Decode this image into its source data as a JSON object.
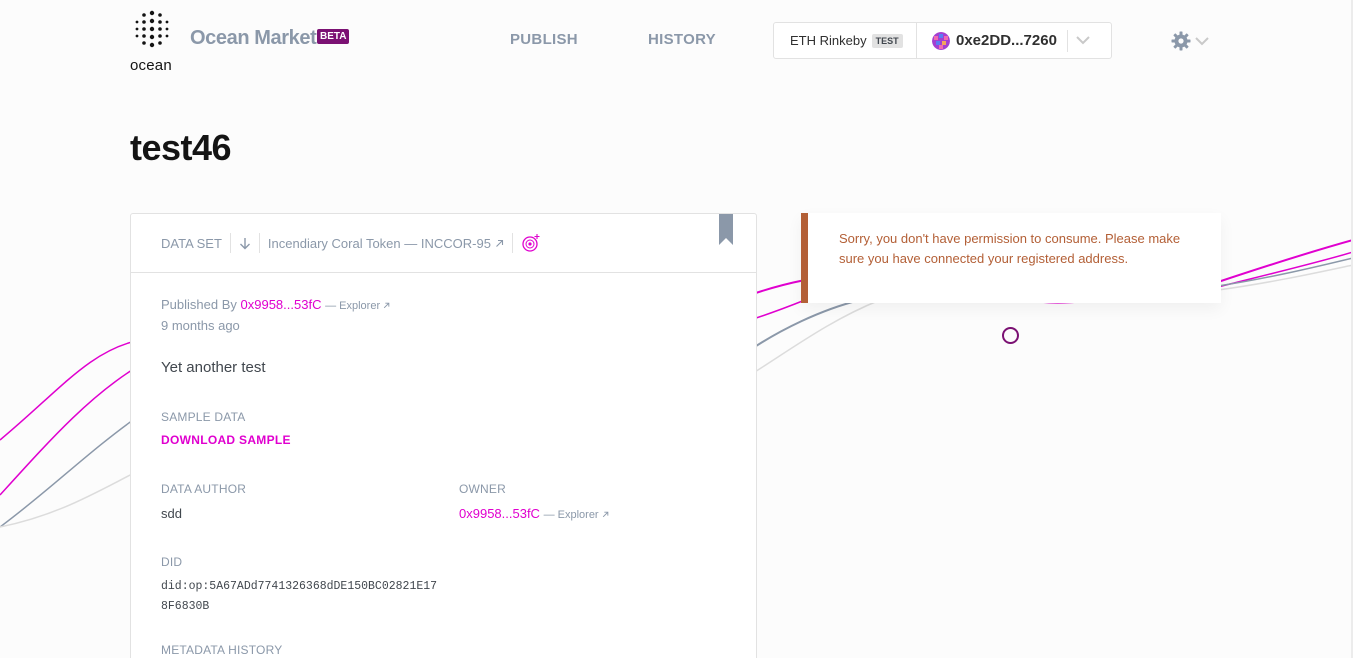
{
  "header": {
    "logo_text": "ocean",
    "brand": "Ocean Market",
    "beta": "BETA",
    "nav": {
      "publish": "PUBLISH",
      "history": "HISTORY"
    },
    "network": {
      "name": "ETH Rinkeby",
      "badge": "TEST"
    },
    "account": {
      "address": "0xe2DD...7260"
    }
  },
  "page": {
    "title": "test46"
  },
  "asset": {
    "type": "DATA SET",
    "token": "Incendiary Coral Token — INCCOR-95",
    "published_by_label": "Published By",
    "publisher": "0x9958...53fC",
    "explorer_label": "— Explorer",
    "published_ago": "9 months ago",
    "description": "Yet another test",
    "sample_label": "SAMPLE DATA",
    "sample_button": "DOWNLOAD SAMPLE",
    "author_label": "DATA AUTHOR",
    "author": "sdd",
    "owner_label": "OWNER",
    "owner": "0x9958...53fC",
    "did_label": "DID",
    "did": "did:op:5A67ADd7741326368dDE150BC02821E178F6830B",
    "metadata_history_label": "METADATA HISTORY"
  },
  "alert": {
    "message": "Sorry, you don't have permission to consume. Please make sure you have connected your registered address."
  },
  "colors": {
    "accent_pink": "#e000cf",
    "brand_purple": "#7b1173",
    "warning": "#b35f36",
    "muted": "#8b98a9"
  },
  "icons": [
    "logo-icon",
    "chevron-down-icon",
    "gear-icon",
    "arrow-down-icon",
    "external-link-icon",
    "datatoken-icon",
    "bookmark-icon",
    "loader-icon"
  ]
}
